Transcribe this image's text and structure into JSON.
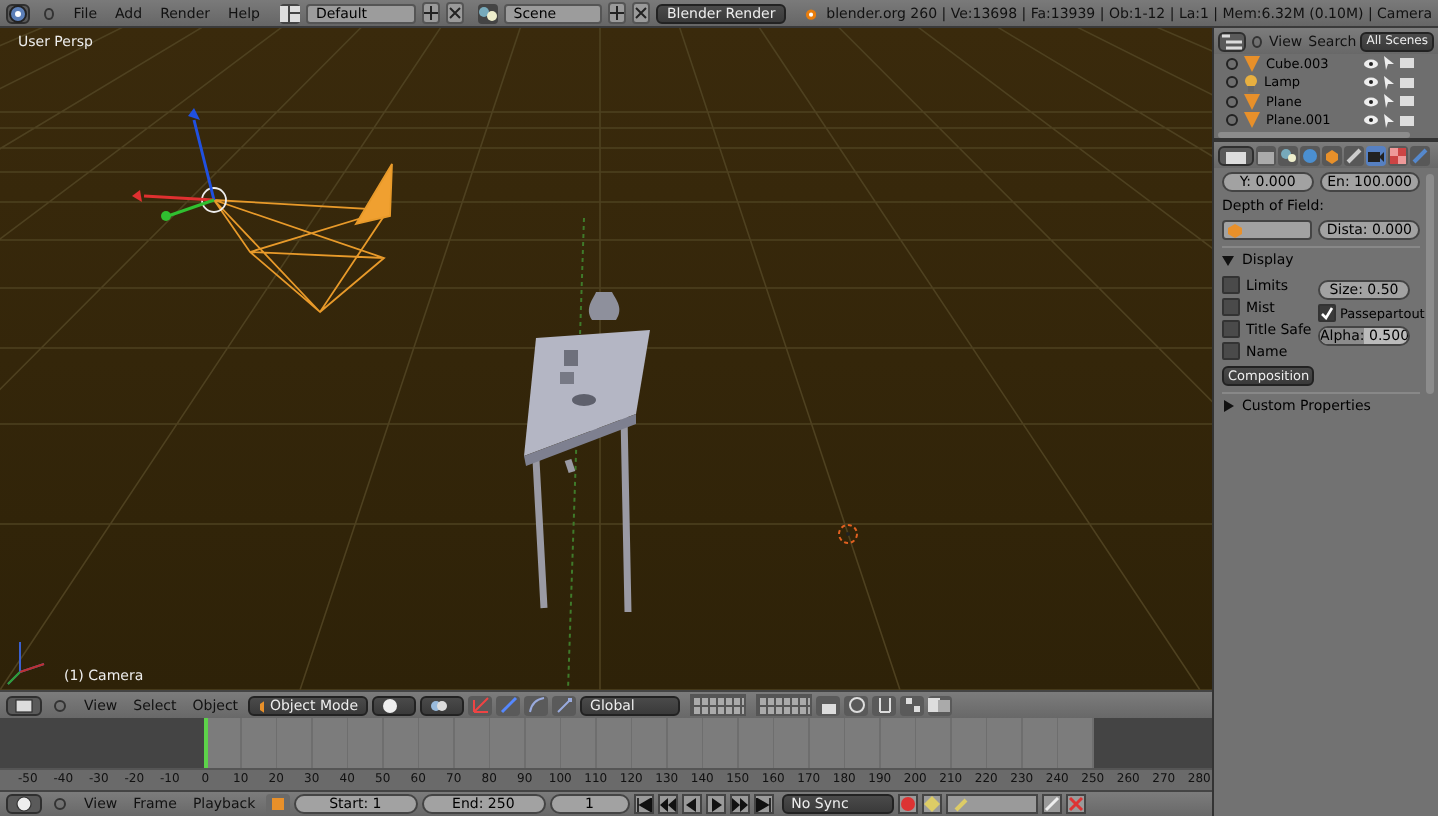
{
  "top_bar": {
    "menus": [
      "File",
      "Add",
      "Render",
      "Help"
    ],
    "screen_layout": "Default",
    "scene": "Scene",
    "render_engine": "Blender Render",
    "stats": "blender.org 260 | Ve:13698 | Fa:13939 | Ob:1-12 | La:1 | Mem:6.32M (0.10M) | Camera"
  },
  "viewport": {
    "view_label": "User Persp",
    "object_label": "(1) Camera"
  },
  "outliner": {
    "menus": [
      "View",
      "Search"
    ],
    "filter": "All Scenes",
    "items": [
      {
        "name": "Cube.003",
        "kind": "mesh"
      },
      {
        "name": "Lamp",
        "kind": "lamp"
      },
      {
        "name": "Plane",
        "kind": "mesh"
      },
      {
        "name": "Plane.001",
        "kind": "mesh"
      }
    ]
  },
  "properties": {
    "tabs": [
      {
        "kind": "render",
        "selected": false
      },
      {
        "kind": "scene",
        "selected": false
      },
      {
        "kind": "world",
        "selected": false
      },
      {
        "kind": "object",
        "selected": false
      },
      {
        "kind": "constraints",
        "selected": false
      },
      {
        "kind": "data",
        "selected": true
      },
      {
        "kind": "material",
        "selected": false
      },
      {
        "kind": "texture",
        "selected": false
      }
    ],
    "y_field": "Y: 0.000",
    "end_field": "En: 100.000",
    "dof_label": "Depth of Field:",
    "distance_field": "Dista: 0.000",
    "display": {
      "title": "Display",
      "expanded": true,
      "checkboxes": [
        {
          "label": "Limits",
          "checked": false
        },
        {
          "label": "Mist",
          "checked": false
        },
        {
          "label": "Title Safe",
          "checked": false
        },
        {
          "label": "Name",
          "checked": false
        }
      ],
      "size_field": "Size: 0.50",
      "passepartout": {
        "label": "Passepartout",
        "checked": true
      },
      "alpha": {
        "text": "Alpha: 0.500",
        "level": 0.5
      },
      "composition": "Composition"
    },
    "custom_properties": {
      "title": "Custom Properties",
      "expanded": false
    }
  },
  "view3d_header": {
    "menus": [
      "View",
      "Select",
      "Object"
    ],
    "mode": "Object Mode",
    "orientation": "Global"
  },
  "timeline": {
    "ticks": [
      "-50",
      "-40",
      "-30",
      "-20",
      "-10",
      "0",
      "10",
      "20",
      "30",
      "40",
      "50",
      "60",
      "70",
      "80",
      "90",
      "100",
      "110",
      "120",
      "130",
      "140",
      "150",
      "160",
      "170",
      "180",
      "190",
      "200",
      "210",
      "220",
      "230",
      "240",
      "250",
      "260",
      "270",
      "280"
    ],
    "menus": [
      "View",
      "Frame",
      "Playback"
    ],
    "start": "Start: 1",
    "end": "End: 250",
    "current": "1",
    "sync": "No Sync"
  }
}
